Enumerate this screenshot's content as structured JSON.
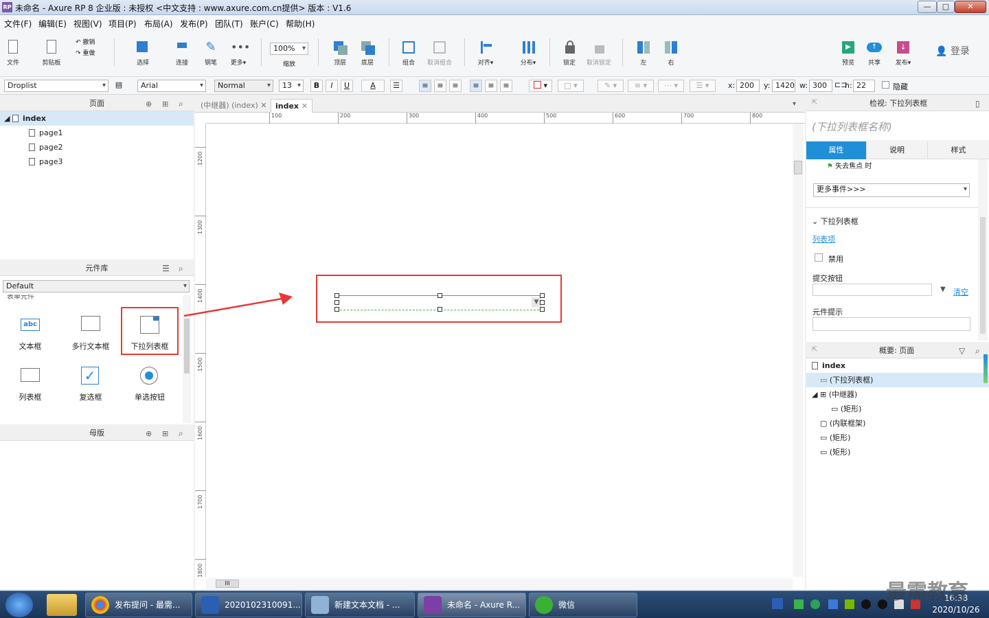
{
  "window": {
    "title": "未命名 - Axure RP 8 企业版 : 未授权    <中文支持 : www.axure.com.cn提供> 版本 : V1.6",
    "app_icon": "RP",
    "min": "—",
    "max": "□",
    "close": "✕"
  },
  "menu": [
    "文件(F)",
    "编辑(E)",
    "视图(V)",
    "项目(P)",
    "布局(A)",
    "发布(P)",
    "团队(T)",
    "账户(C)",
    "帮助(H)"
  ],
  "toolbar": {
    "file": "文件",
    "clipboard": "剪贴板",
    "undo": "撤销",
    "redo": "重做",
    "select": "选择",
    "connect": "连接",
    "pen": "钢笔",
    "more": "更多▾",
    "zoom_value": "100%",
    "zoom": "缩放",
    "top": "顶层",
    "bottom": "底层",
    "group": "组合",
    "ungroup": "取消组合",
    "align": "对齐▾",
    "distribute": "分布▾",
    "lock": "锁定",
    "unlock": "取消锁定",
    "left": "左",
    "right": "右",
    "preview": "预览",
    "share": "共享",
    "publish": "发布▾",
    "login": "登录"
  },
  "format": {
    "widget_type": "Droplist",
    "font": "Arial",
    "style": "Normal",
    "size": "13",
    "bold": "B",
    "italic": "I",
    "underline": "U",
    "fontcolor": "A",
    "x_label": "x:",
    "x": "200",
    "y_label": "y:",
    "y": "1420",
    "w_label": "w:",
    "w": "300",
    "h_label": "h:",
    "h": "22",
    "hidden": "隐藏"
  },
  "pages_panel": {
    "title": "页面",
    "items": [
      {
        "label": "index",
        "level": 0
      },
      {
        "label": "page1",
        "level": 1
      },
      {
        "label": "page2",
        "level": 1
      },
      {
        "label": "page3",
        "level": 1
      }
    ]
  },
  "library_panel": {
    "title": "元件库",
    "library": "Default",
    "section": "表单元件",
    "widgets": [
      "文本框",
      "多行文本框",
      "下拉列表框",
      "列表框",
      "复选框",
      "单选按钮"
    ]
  },
  "masters_panel": {
    "title": "母版"
  },
  "canvas": {
    "tabs": [
      "(中继器) (index)",
      "index"
    ],
    "ruler_h": [
      "100",
      "200",
      "300",
      "400",
      "500",
      "600",
      "700",
      "800"
    ],
    "ruler_v": [
      "1200",
      "1300",
      "1400",
      "1500",
      "1600",
      "1700",
      "1800"
    ],
    "scroll_h": "III"
  },
  "inspector": {
    "header": "检视: 下拉列表框",
    "name_placeholder": "(下拉列表框名称)",
    "tabs": [
      "属性",
      "说明",
      "样式"
    ],
    "event": "失去焦点 时",
    "more_events": "更多事件>>>",
    "section": "下拉列表框",
    "list_items_link": "列表项",
    "disabled": "禁用",
    "submit_button": "提交按钮",
    "clear": "清空",
    "tooltip": "元件提示"
  },
  "outline": {
    "header": "概要: 页面",
    "items": [
      {
        "label": "index",
        "level": 0
      },
      {
        "label": "(下拉列表框)",
        "level": 1
      },
      {
        "label": "(中继器)",
        "level": 1
      },
      {
        "label": "(矩形)",
        "level": 2
      },
      {
        "label": "(内联框架)",
        "level": 1
      },
      {
        "label": "(矩形)",
        "level": 1
      },
      {
        "label": "(矩形)",
        "level": 1
      }
    ]
  },
  "taskbar": {
    "items": [
      "发布提问 - 最需...",
      "2020102310091...",
      "新建文本文档 - ...",
      "未命名 - Axure R...",
      "微信"
    ],
    "time": "16:38",
    "date": "2020/10/26",
    "watermark": "最需教育"
  },
  "colors": {
    "accent": "#1f8fd8",
    "highlight_red": "#e53935",
    "selection_green": "#3bb54a"
  }
}
